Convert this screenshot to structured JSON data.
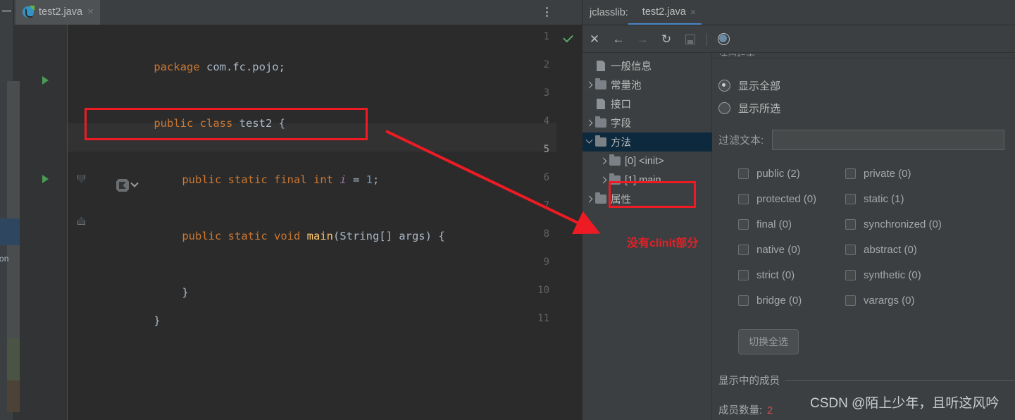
{
  "editor": {
    "tab": {
      "name": "test2.java",
      "close": "×",
      "icon": "java-class-icon"
    },
    "vertical_tool_label": "ion",
    "lines": [
      {
        "no": "1",
        "segs": [
          {
            "t": "package ",
            "c": "kw"
          },
          {
            "t": "com.fc.pojo;",
            "c": "pl"
          }
        ]
      },
      {
        "no": "2",
        "segs": []
      },
      {
        "no": "3",
        "run": true,
        "segs": [
          {
            "t": "public ",
            "c": "kw"
          },
          {
            "t": "class ",
            "c": "kw"
          },
          {
            "t": "test2 {",
            "c": "cls"
          }
        ]
      },
      {
        "no": "4",
        "segs": []
      },
      {
        "no": "5",
        "cur": true,
        "hl": true,
        "indent": 1,
        "segs": [
          {
            "t": "public ",
            "c": "kw"
          },
          {
            "t": "static ",
            "c": "kw"
          },
          {
            "t": "final ",
            "c": "kw"
          },
          {
            "t": "int ",
            "c": "kw"
          },
          {
            "t": "i",
            "c": "id"
          },
          {
            "t": " = ",
            "c": "pl"
          },
          {
            "t": "1",
            "c": "num"
          },
          {
            "t": ";",
            "c": "pl"
          }
        ]
      },
      {
        "no": "6",
        "segs": []
      },
      {
        "no": "7",
        "run": true,
        "fold": "open",
        "indent": 1,
        "segs": [
          {
            "t": "public ",
            "c": "kw"
          },
          {
            "t": "static ",
            "c": "kw"
          },
          {
            "t": "void ",
            "c": "kw"
          },
          {
            "t": "main",
            "c": "fn"
          },
          {
            "t": "(String[] args) {",
            "c": "pl"
          }
        ]
      },
      {
        "no": "8",
        "segs": []
      },
      {
        "no": "9",
        "fold": "close",
        "indent": 1,
        "segs": [
          {
            "t": "}",
            "c": "pl"
          }
        ]
      },
      {
        "no": "10",
        "segs": [
          {
            "t": "}",
            "c": "pl"
          }
        ]
      },
      {
        "no": "11",
        "segs": []
      }
    ],
    "inspection_status": "ok-check-icon",
    "gutter_run_config": "run-configuration-icon"
  },
  "jclasslib": {
    "title": "jclasslib:",
    "tab": {
      "name": "test2.java",
      "close": "×"
    },
    "toolbar": [
      {
        "name": "close-button",
        "glyph": "✕",
        "dim": false
      },
      {
        "name": "back-button",
        "glyph": "←",
        "dim": false
      },
      {
        "name": "forward-button",
        "glyph": "→",
        "dim": true
      },
      {
        "name": "reload-button",
        "glyph": "↻",
        "dim": false
      },
      {
        "name": "save-button",
        "glyph": "",
        "dim": true
      },
      {
        "name": "browse-button",
        "glyph": "",
        "dim": false
      }
    ],
    "tree": [
      {
        "label": "一般信息",
        "icon": "document-icon",
        "expander": "",
        "indent": 0,
        "selected": false
      },
      {
        "label": "常量池",
        "icon": "folder-icon",
        "expander": "right",
        "indent": 0,
        "selected": false
      },
      {
        "label": "接口",
        "icon": "document-icon",
        "expander": "",
        "indent": 0,
        "selected": false
      },
      {
        "label": "字段",
        "icon": "folder-icon",
        "expander": "right",
        "indent": 0,
        "selected": false
      },
      {
        "label": "方法",
        "icon": "folder-icon",
        "expander": "down",
        "indent": 0,
        "selected": true
      },
      {
        "label": "[0] <init>",
        "icon": "folder-icon",
        "expander": "right",
        "indent": 1,
        "selected": false
      },
      {
        "label": "[1] main",
        "icon": "folder-icon",
        "expander": "right",
        "indent": 1,
        "selected": false
      },
      {
        "label": "属性",
        "icon": "folder-icon",
        "expander": "right",
        "indent": 0,
        "selected": false
      }
    ],
    "clipped_section_title": "访问标志",
    "radios": [
      {
        "label": "显示全部",
        "checked": true
      },
      {
        "label": "显示所选",
        "checked": false
      }
    ],
    "filter": {
      "label": "过滤文本:",
      "value": "",
      "placeholder": ""
    },
    "modifiers": [
      {
        "label": "public (2)",
        "checked": false
      },
      {
        "label": "private (0)",
        "checked": false
      },
      {
        "label": "protected (0)",
        "checked": false
      },
      {
        "label": "static (1)",
        "checked": false
      },
      {
        "label": "final (0)",
        "checked": false
      },
      {
        "label": "synchronized (0)",
        "checked": false
      },
      {
        "label": "native (0)",
        "checked": false
      },
      {
        "label": "abstract (0)",
        "checked": false
      },
      {
        "label": "strict (0)",
        "checked": false
      },
      {
        "label": "synthetic (0)",
        "checked": false
      },
      {
        "label": "bridge (0)",
        "checked": false
      },
      {
        "label": "varargs (0)",
        "checked": false
      }
    ],
    "toggle_all_button": "切换全选",
    "members_section": "显示中的成员",
    "member_count": {
      "label": "成员数量:",
      "value": "2"
    }
  },
  "annotations": {
    "note": "没有clinit部分",
    "color": "#e81f26"
  },
  "watermark": "CSDN @陌上少年，且听这风吟"
}
